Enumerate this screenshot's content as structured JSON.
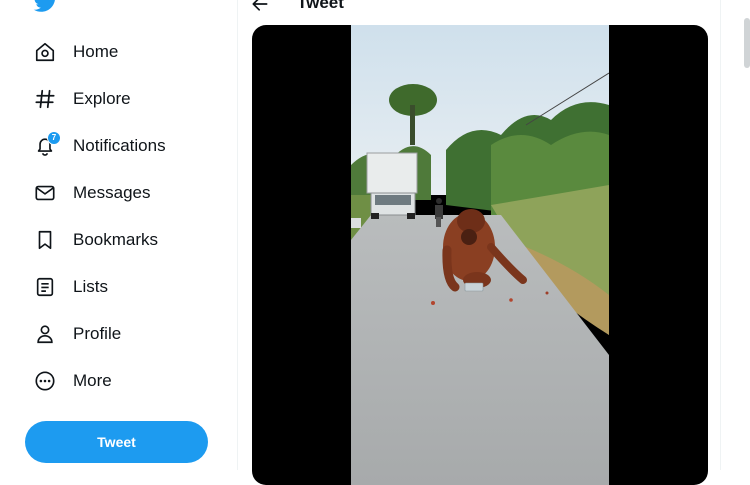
{
  "sidebar": {
    "logo_icon": "twitter-bird-icon",
    "items": [
      {
        "label": "Home",
        "icon": "home-icon"
      },
      {
        "label": "Explore",
        "icon": "hashtag-icon"
      },
      {
        "label": "Notifications",
        "icon": "bell-icon",
        "badge": "7"
      },
      {
        "label": "Messages",
        "icon": "envelope-icon"
      },
      {
        "label": "Bookmarks",
        "icon": "bookmark-icon"
      },
      {
        "label": "Lists",
        "icon": "list-icon"
      },
      {
        "label": "Profile",
        "icon": "person-icon"
      },
      {
        "label": "More",
        "icon": "more-circle-icon"
      }
    ],
    "tweet_button": "Tweet"
  },
  "header": {
    "back_icon": "back-arrow-icon",
    "title": "Tweet"
  },
  "media": {
    "type": "video",
    "description_icon": "video-frame"
  },
  "colors": {
    "accent": "#1d9bf0",
    "text": "#0f1419",
    "divider": "#eff3f4",
    "video_bg": "#000000"
  }
}
